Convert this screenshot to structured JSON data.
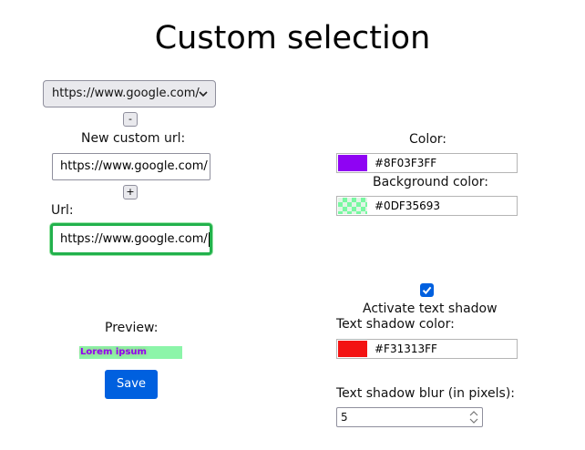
{
  "page": {
    "title": "Custom selection"
  },
  "left": {
    "url_select": {
      "selected": "https://www.google.com/"
    },
    "remove_button": "-",
    "new_url_label": "New custom url:",
    "new_url_value": "https://www.google.com/",
    "add_button": "+",
    "url_label": "Url:",
    "url_value": "https://www.google.com/",
    "preview_label": "Preview:",
    "preview_text": "Lorem ipsum",
    "save_label": "Save"
  },
  "right": {
    "color_label": "Color:",
    "color_value": "#8F03F3FF",
    "bg_label": "Background color:",
    "bg_value": "#0DF35693",
    "shadow_checkbox_checked": true,
    "shadow_label": "Activate text shadow",
    "shadow_color_label": "Text shadow color:",
    "shadow_color_value": "#F31313FF",
    "shadow_blur_label": "Text shadow blur (in pixels):",
    "shadow_blur_value": "5"
  },
  "colors": {
    "text_color": "#8f03f3",
    "shadow_color": "#f31313",
    "background": "#8cf5a9",
    "accent": "#0060df",
    "focus": "#22b14c"
  },
  "icons": {
    "select": "chevron-down-icon",
    "checkbox": "checkmark-icon",
    "spinner": "spinner-arrows-icon"
  }
}
